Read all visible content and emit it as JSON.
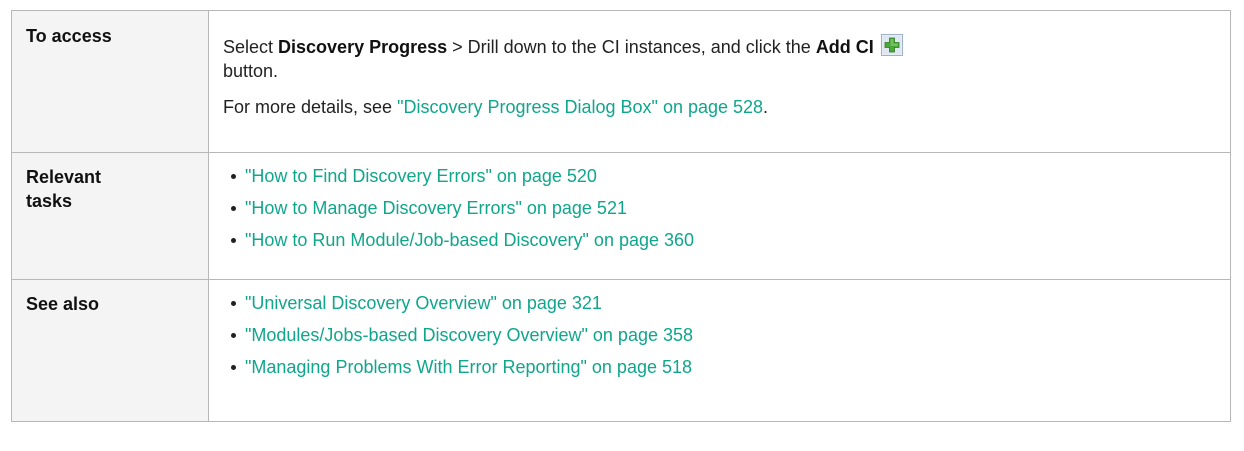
{
  "rows": {
    "access": {
      "label": "To access",
      "line1_pre": "Select ",
      "line1_bold1": "Discovery Progress",
      "line1_mid": " > Drill down to the CI instances, and click the ",
      "line1_bold2": "Add CI",
      "add_ci_icon": "add-ci-plus-icon",
      "line1_post": "button.",
      "line2_pre": "For more details, see ",
      "line2_link": "\"Discovery Progress Dialog Box\" on page 528",
      "line2_post": "."
    },
    "relevant_tasks": {
      "label": "Relevant tasks",
      "items": [
        "\"How to Find Discovery Errors\" on page 520",
        "\"How to Manage Discovery Errors\" on page 521",
        "\"How to Run Module/Job-based Discovery\" on page 360"
      ]
    },
    "see_also": {
      "label": "See also",
      "items": [
        "\"Universal Discovery Overview\" on page 321",
        "\"Modules/Jobs-based Discovery Overview\" on page 358",
        "\"Managing Problems With Error Reporting\" on page 518"
      ]
    }
  },
  "colors": {
    "link": "#0fa68c",
    "border": "#b8b8b8",
    "label_bg": "#f4f4f4"
  }
}
